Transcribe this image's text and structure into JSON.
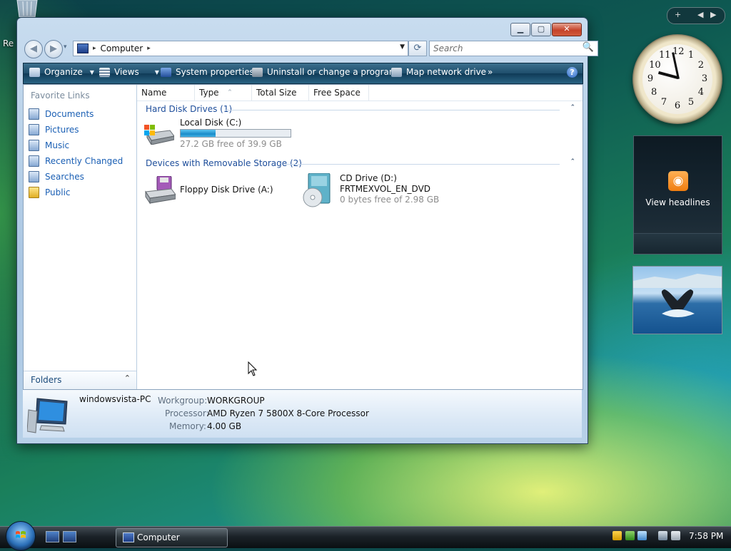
{
  "desktop": {
    "recycle_label_fragment": "Re"
  },
  "window": {
    "caption_buttons": {
      "minimize": "▁",
      "maximize": "▢",
      "close": "✕"
    },
    "nav": {
      "back": "◀",
      "forward": "▶",
      "history": "▾"
    },
    "address": {
      "crumb": "Computer",
      "separator": "▸",
      "dropdown": "▼"
    },
    "refresh_glyph": "⟳",
    "search": {
      "placeholder": "Search",
      "glyph": "🔍"
    },
    "toolbar": {
      "organize": "Organize",
      "views": "Views",
      "system_properties": "System properties",
      "uninstall": "Uninstall or change a program",
      "map_drive": "Map network drive",
      "more": "»",
      "help": "?"
    },
    "nav_pane": {
      "title": "Favorite Links",
      "items": [
        "Documents",
        "Pictures",
        "Music",
        "Recently Changed",
        "Searches",
        "Public"
      ],
      "folders_label": "Folders",
      "folders_chevron": "⌃"
    },
    "columns": [
      "Name",
      "Type",
      "Total Size",
      "Free Space"
    ],
    "groups": [
      {
        "title": "Hard Disk Drives (1)",
        "drives": [
          {
            "name": "Local Disk (C:)",
            "free_text": "27.2 GB free of 39.9 GB",
            "used_fraction": 0.318
          }
        ]
      },
      {
        "title": "Devices with Removable Storage (2)",
        "drives": [
          {
            "name": "Floppy Disk Drive (A:)"
          },
          {
            "name": "CD Drive (D:)",
            "label": "FRTMEXVOL_EN_DVD",
            "free_text": "0 bytes free of 2.98 GB"
          }
        ]
      }
    ],
    "group_chevron": "⌃",
    "details": {
      "pc_name": "windowsvista-PC",
      "workgroup_key": "Workgroup:",
      "workgroup_val": "WORKGROUP",
      "processor_key": "Processor:",
      "processor_val": "AMD Ryzen 7 5800X 8-Core Processor",
      "memory_key": "Memory:",
      "memory_val": "4.00 GB"
    }
  },
  "sidebar": {
    "add": "+",
    "prev": "◀",
    "next": "▶",
    "clock_numbers": [
      "12",
      "1",
      "2",
      "3",
      "4",
      "5",
      "6",
      "7",
      "8",
      "9",
      "10",
      "11"
    ],
    "clock_hour_deg": 255,
    "clock_minute_deg": 258,
    "feed_label": "View headlines",
    "feed_glyph": "◉"
  },
  "taskbar": {
    "task_button": "Computer",
    "clock": "7:58 PM"
  },
  "colors": {
    "link": "#1a5fb4",
    "group_header": "#1e4e9b",
    "capacity_bar": "#1a8cc9",
    "toolbar": "#1f4e6c"
  }
}
